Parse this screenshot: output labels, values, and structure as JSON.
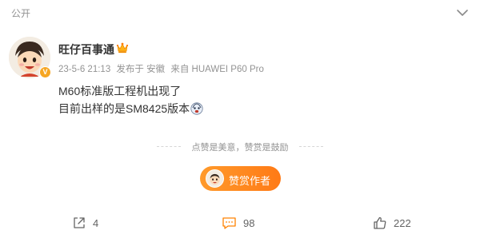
{
  "header": {
    "visibility": "公开"
  },
  "post": {
    "author": "旺仔百事通",
    "time": "23-5-6 21:13",
    "location": "发布于 安徽",
    "source": "来自 HUAWEI P60 Pro",
    "lines": [
      "M60标准版工程机出现了",
      "目前出样的是SM8425版本"
    ]
  },
  "reward": {
    "note": "点赞是美意，赞赏是鼓励",
    "button_label": "赞赏作者"
  },
  "actions": {
    "share_count": "4",
    "comment_count": "98",
    "like_count": "222"
  },
  "colors": {
    "accent": "#ff8200",
    "text_muted": "#939393"
  }
}
